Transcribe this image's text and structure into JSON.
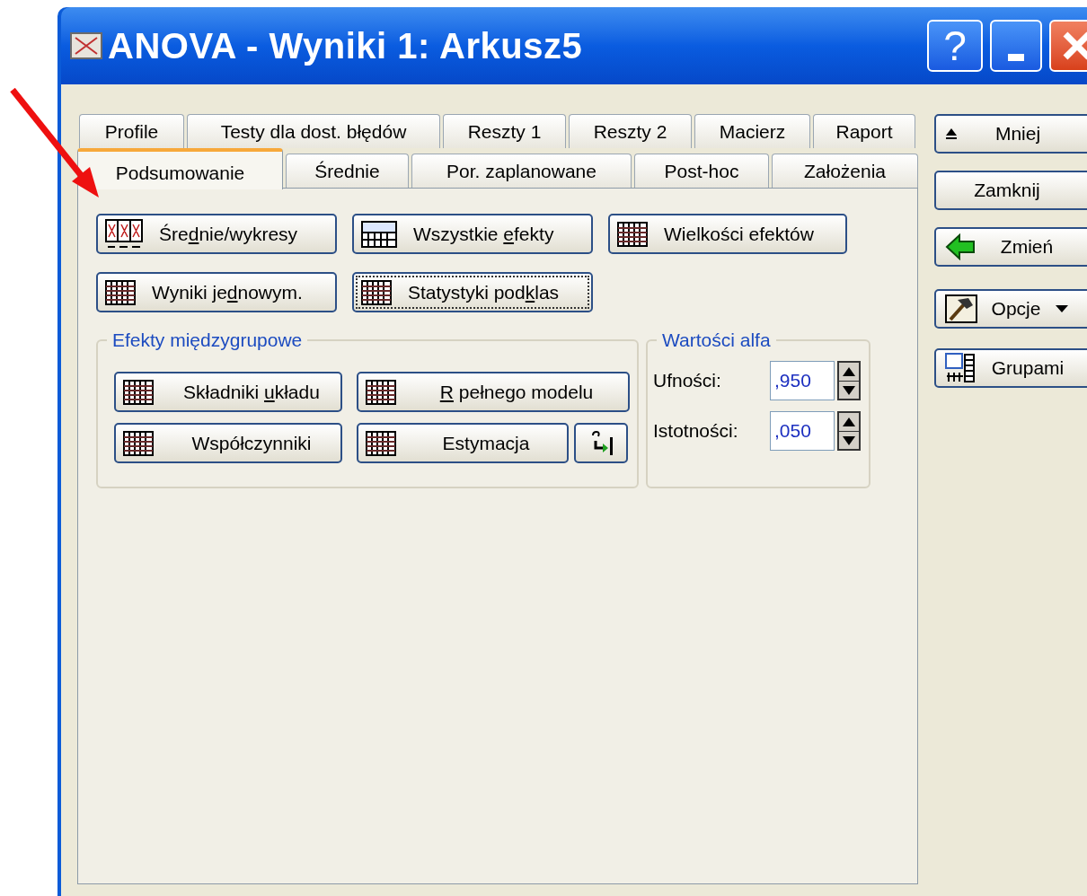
{
  "window": {
    "title": "ANOVA - Wyniki 1: Arkusz5",
    "help_button": "?"
  },
  "tabs_row_1": [
    {
      "label": "Profile",
      "selected": false
    },
    {
      "label": "Testy dla dost. błędów",
      "selected": false
    },
    {
      "label": "Reszty 1",
      "selected": false
    },
    {
      "label": "Reszty 2",
      "selected": false
    },
    {
      "label": "Macierz",
      "selected": false
    },
    {
      "label": "Raport",
      "selected": false
    }
  ],
  "tabs_row_2": [
    {
      "label": "Podsumowanie",
      "selected": true
    },
    {
      "label": "Średnie",
      "selected": false
    },
    {
      "label": "Por. zaplanowane",
      "selected": false
    },
    {
      "label": "Post-hoc",
      "selected": false
    },
    {
      "label": "Założenia",
      "selected": false
    }
  ],
  "buttons": [
    {
      "label": "Średnie/wykresy",
      "focused": false
    },
    {
      "label": "Wszystkie efekty",
      "focused": false
    },
    {
      "label": "Wielkości efektów",
      "focused": false
    },
    {
      "label": "Wyniki jednowym.",
      "focused": false
    },
    {
      "label": "Statystyki podklas",
      "focused": true
    }
  ],
  "between_group_effects": {
    "title": "Efekty międzygrupowe",
    "buttons": [
      {
        "label": "Składniki układu"
      },
      {
        "label": "R pełnego modelu"
      },
      {
        "label": "Współczynniki"
      },
      {
        "label": "Estymacja"
      }
    ]
  },
  "alpha_values": {
    "title": "Wartości alfa",
    "fields": [
      {
        "label": "Ufności:",
        "value": ",950"
      },
      {
        "label": "Istotności:",
        "value": ",050"
      }
    ]
  },
  "side_buttons": [
    {
      "label": "Mniej"
    },
    {
      "label": "Zamknij"
    },
    {
      "label": "Zmień"
    },
    {
      "label": "Opcje"
    },
    {
      "label": "Grupami"
    }
  ]
}
